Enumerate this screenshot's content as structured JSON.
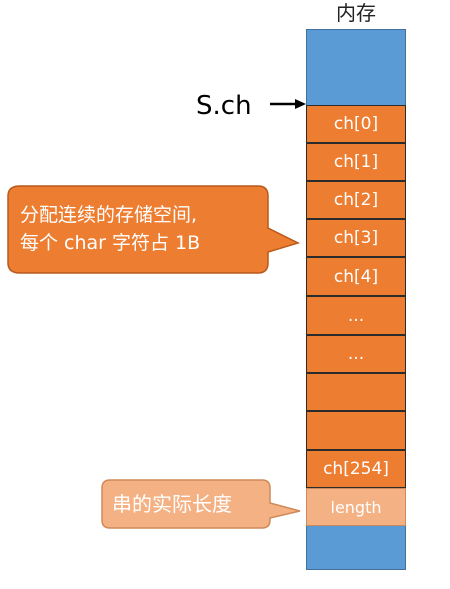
{
  "memory": {
    "title": "内存",
    "cells": [
      "ch[0]",
      "ch[1]",
      "ch[2]",
      "ch[3]",
      "ch[4]",
      "...",
      "...",
      "",
      "",
      "ch[254]"
    ],
    "length_label": "length"
  },
  "pointer": {
    "label": "S.ch"
  },
  "callouts": {
    "alloc": {
      "line1": "分配连续的存储空间,",
      "line2": "每个 char 字符占 1B"
    },
    "length": {
      "text": "串的实际长度"
    }
  },
  "colors": {
    "memory_bg": "#5b9bd5",
    "cell_orange": "#ed7d31",
    "cell_light": "#f4b183",
    "callout_dark": "#ed7d31",
    "callout_light": "#f4b183"
  }
}
